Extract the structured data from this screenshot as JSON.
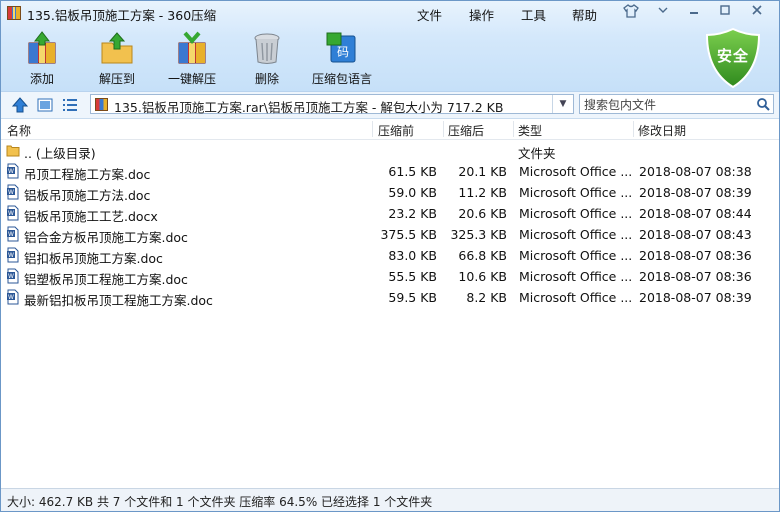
{
  "window": {
    "title": "135.铝板吊顶施工方案 - 360压缩",
    "menu": [
      "文件",
      "操作",
      "工具",
      "帮助"
    ]
  },
  "toolbar": {
    "add": "添加",
    "extract_to": "解压到",
    "one_click_extract": "一键解压",
    "delete": "删除",
    "comment": "压缩包语言"
  },
  "security_badge": "安全",
  "address": {
    "path": "135.铝板吊顶施工方案.rar\\铝板吊顶施工方案 - 解包大小为 717.2 KB"
  },
  "search": {
    "placeholder": "搜索包内文件"
  },
  "columns": {
    "name": "名称",
    "compressed": "压缩前",
    "packed": "压缩后",
    "type": "类型",
    "modified": "修改日期"
  },
  "parent_dir": {
    "name": ".. (上级目录)",
    "type": "文件夹"
  },
  "files": [
    {
      "name": "吊顶工程施工方案.doc",
      "before": "61.5 KB",
      "after": "20.1 KB",
      "type": "Microsoft Office ...",
      "date": "2018-08-07 08:38"
    },
    {
      "name": "铝板吊顶施工方法.doc",
      "before": "59.0 KB",
      "after": "11.2 KB",
      "type": "Microsoft Office ...",
      "date": "2018-08-07 08:39"
    },
    {
      "name": "铝板吊顶施工工艺.docx",
      "before": "23.2 KB",
      "after": "20.6 KB",
      "type": "Microsoft Office ...",
      "date": "2018-08-07 08:44"
    },
    {
      "name": "铝合金方板吊顶施工方案.doc",
      "before": "375.5 KB",
      "after": "325.3 KB",
      "type": "Microsoft Office ...",
      "date": "2018-08-07 08:43"
    },
    {
      "name": "铝扣板吊顶施工方案.doc",
      "before": "83.0 KB",
      "after": "66.8 KB",
      "type": "Microsoft Office ...",
      "date": "2018-08-07 08:36"
    },
    {
      "name": "铝塑板吊顶工程施工方案.doc",
      "before": "55.5 KB",
      "after": "10.6 KB",
      "type": "Microsoft Office ...",
      "date": "2018-08-07 08:36"
    },
    {
      "name": "最新铝扣板吊顶工程施工方案.doc",
      "before": "59.5 KB",
      "after": "8.2 KB",
      "type": "Microsoft Office ...",
      "date": "2018-08-07 08:39"
    }
  ],
  "status": "大小: 462.7 KB 共 7 个文件和 1 个文件夹 压缩率 64.5% 已经选择 1 个文件夹",
  "colors": {
    "toolbar_top": "#e8f3fd",
    "toolbar_bottom": "#c6e0f8",
    "shield": "#4aa52e"
  }
}
